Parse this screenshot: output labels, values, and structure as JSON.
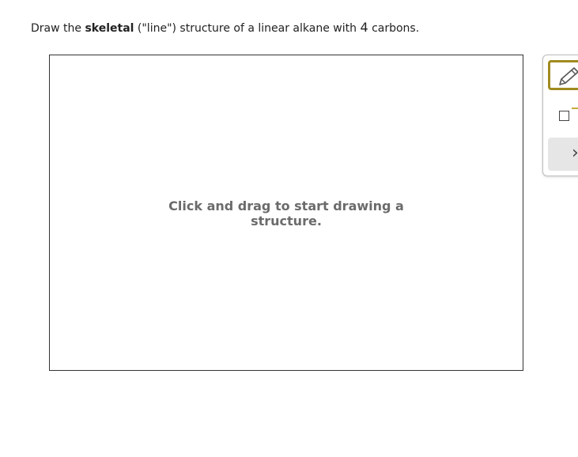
{
  "question": {
    "text_before": "Draw the ",
    "bold_term": "skeletal",
    "text_middle": " (\"line\") structure of a linear alkane with ",
    "number": "4",
    "text_after": " carbons."
  },
  "canvas": {
    "hint_line1": "Click and drag to start drawing a",
    "hint_line2": "structure."
  },
  "toolbar": {
    "tools": [
      {
        "name": "pencil-tool",
        "icon": "pencil-icon",
        "selected": true
      },
      {
        "name": "box-tool",
        "icon": "square-icon",
        "selected": false
      },
      {
        "name": "next-tool",
        "icon": "chevron-right-icon",
        "selected": false
      }
    ],
    "accent_color": "#a08a1e"
  }
}
